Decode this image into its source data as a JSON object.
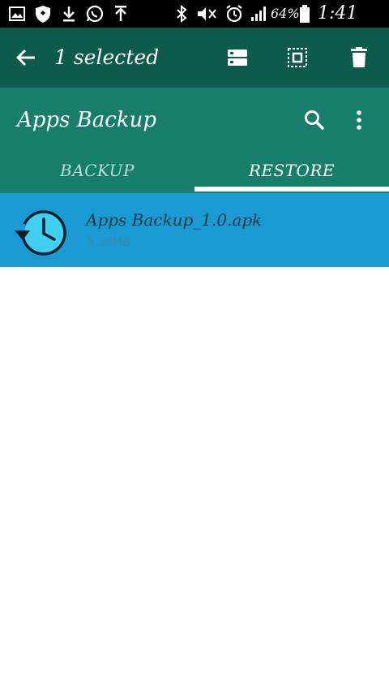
{
  "status_bar": {
    "battery": "64%",
    "time": "1:41 PM",
    "icons": [
      "image-icon",
      "shield-icon",
      "download-icon",
      "whatsapp-icon",
      "upload-icon",
      "bluetooth-icon",
      "mute-icon",
      "alarm-icon",
      "signal-icon",
      "battery-icon"
    ]
  },
  "contextual_bar": {
    "title": "1 selected",
    "icons": [
      "back-arrow-icon",
      "list-select-icon",
      "select-all-icon",
      "delete-icon"
    ]
  },
  "toolbar": {
    "title": "Apps Backup",
    "icons": [
      "search-icon",
      "more-vert-icon"
    ]
  },
  "tabs": [
    {
      "label": "BACKUP",
      "selected": false
    },
    {
      "label": "RESTORE",
      "selected": true
    }
  ],
  "list": {
    "items": [
      {
        "name": "Apps Backup_1.0.apk",
        "size": "5.32MB",
        "icon": "restore-clock-icon"
      }
    ]
  },
  "colors": {
    "status_bar": "#000000",
    "contextual_bar": "#0d5c4b",
    "toolbar": "#167e6b",
    "selected_item": "#1a9ad3",
    "icon_fill": "#3fd0f0"
  }
}
